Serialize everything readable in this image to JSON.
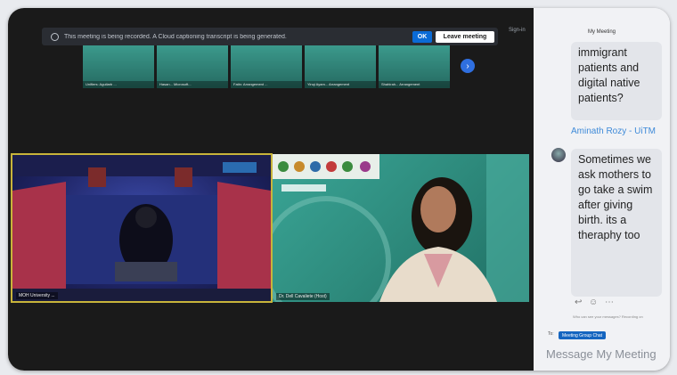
{
  "banner": {
    "text": "This meeting is being recorded. A Cloud captioning transcript is being generated.",
    "ok_label": "OK",
    "leave_label": "Leave meeting"
  },
  "top_right_label": "Sign-in",
  "thumbnails": [
    {
      "name": "Unifiers: Aguilarb ..."
    },
    {
      "name": "Hasan... Microsoft..."
    },
    {
      "name": "Fatin: Arrangement ..."
    },
    {
      "name": "Yinqi Ayam... Arrangement"
    },
    {
      "name": "Shahirah... Arrangement"
    }
  ],
  "videos": {
    "left_label": "MOH University ...",
    "right_label": "Dr. Dell Cavaliete (Host)"
  },
  "chat": {
    "title": "My Meeting",
    "messages": [
      {
        "text": "immigrant patients and digital native patients?"
      },
      {
        "sender": "Aminath Rozy - UiTM",
        "text": "Sometimes we ask mothers to go take a swim after giving birth. its a theraphy too"
      }
    ],
    "reactions": [
      "↩",
      "☺",
      "⋯"
    ],
    "who_can_see": "Who can see your messages? Recording on",
    "to_label": "To:",
    "to_button": "Meeting Group Chat",
    "input_placeholder": "Message My Meeting"
  }
}
